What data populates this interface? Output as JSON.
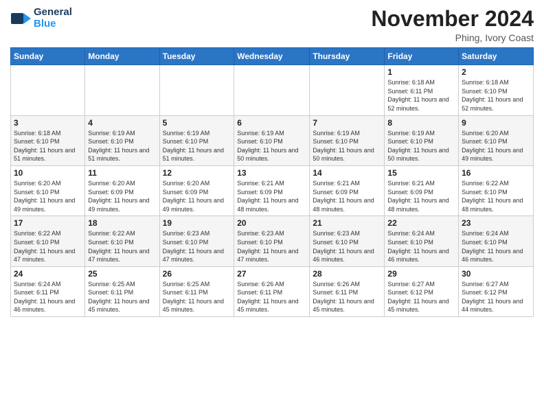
{
  "logo": {
    "line1": "General",
    "line2": "Blue"
  },
  "header": {
    "month": "November 2024",
    "location": "Phing, Ivory Coast"
  },
  "weekdays": [
    "Sunday",
    "Monday",
    "Tuesday",
    "Wednesday",
    "Thursday",
    "Friday",
    "Saturday"
  ],
  "weeks": [
    [
      {
        "day": "",
        "info": ""
      },
      {
        "day": "",
        "info": ""
      },
      {
        "day": "",
        "info": ""
      },
      {
        "day": "",
        "info": ""
      },
      {
        "day": "",
        "info": ""
      },
      {
        "day": "1",
        "info": "Sunrise: 6:18 AM\nSunset: 6:11 PM\nDaylight: 11 hours\nand 52 minutes."
      },
      {
        "day": "2",
        "info": "Sunrise: 6:18 AM\nSunset: 6:10 PM\nDaylight: 11 hours\nand 52 minutes."
      }
    ],
    [
      {
        "day": "3",
        "info": "Sunrise: 6:18 AM\nSunset: 6:10 PM\nDaylight: 11 hours\nand 51 minutes."
      },
      {
        "day": "4",
        "info": "Sunrise: 6:19 AM\nSunset: 6:10 PM\nDaylight: 11 hours\nand 51 minutes."
      },
      {
        "day": "5",
        "info": "Sunrise: 6:19 AM\nSunset: 6:10 PM\nDaylight: 11 hours\nand 51 minutes."
      },
      {
        "day": "6",
        "info": "Sunrise: 6:19 AM\nSunset: 6:10 PM\nDaylight: 11 hours\nand 50 minutes."
      },
      {
        "day": "7",
        "info": "Sunrise: 6:19 AM\nSunset: 6:10 PM\nDaylight: 11 hours\nand 50 minutes."
      },
      {
        "day": "8",
        "info": "Sunrise: 6:19 AM\nSunset: 6:10 PM\nDaylight: 11 hours\nand 50 minutes."
      },
      {
        "day": "9",
        "info": "Sunrise: 6:20 AM\nSunset: 6:10 PM\nDaylight: 11 hours\nand 49 minutes."
      }
    ],
    [
      {
        "day": "10",
        "info": "Sunrise: 6:20 AM\nSunset: 6:10 PM\nDaylight: 11 hours\nand 49 minutes."
      },
      {
        "day": "11",
        "info": "Sunrise: 6:20 AM\nSunset: 6:09 PM\nDaylight: 11 hours\nand 49 minutes."
      },
      {
        "day": "12",
        "info": "Sunrise: 6:20 AM\nSunset: 6:09 PM\nDaylight: 11 hours\nand 49 minutes."
      },
      {
        "day": "13",
        "info": "Sunrise: 6:21 AM\nSunset: 6:09 PM\nDaylight: 11 hours\nand 48 minutes."
      },
      {
        "day": "14",
        "info": "Sunrise: 6:21 AM\nSunset: 6:09 PM\nDaylight: 11 hours\nand 48 minutes."
      },
      {
        "day": "15",
        "info": "Sunrise: 6:21 AM\nSunset: 6:09 PM\nDaylight: 11 hours\nand 48 minutes."
      },
      {
        "day": "16",
        "info": "Sunrise: 6:22 AM\nSunset: 6:10 PM\nDaylight: 11 hours\nand 48 minutes."
      }
    ],
    [
      {
        "day": "17",
        "info": "Sunrise: 6:22 AM\nSunset: 6:10 PM\nDaylight: 11 hours\nand 47 minutes."
      },
      {
        "day": "18",
        "info": "Sunrise: 6:22 AM\nSunset: 6:10 PM\nDaylight: 11 hours\nand 47 minutes."
      },
      {
        "day": "19",
        "info": "Sunrise: 6:23 AM\nSunset: 6:10 PM\nDaylight: 11 hours\nand 47 minutes."
      },
      {
        "day": "20",
        "info": "Sunrise: 6:23 AM\nSunset: 6:10 PM\nDaylight: 11 hours\nand 47 minutes."
      },
      {
        "day": "21",
        "info": "Sunrise: 6:23 AM\nSunset: 6:10 PM\nDaylight: 11 hours\nand 46 minutes."
      },
      {
        "day": "22",
        "info": "Sunrise: 6:24 AM\nSunset: 6:10 PM\nDaylight: 11 hours\nand 46 minutes."
      },
      {
        "day": "23",
        "info": "Sunrise: 6:24 AM\nSunset: 6:10 PM\nDaylight: 11 hours\nand 46 minutes."
      }
    ],
    [
      {
        "day": "24",
        "info": "Sunrise: 6:24 AM\nSunset: 6:11 PM\nDaylight: 11 hours\nand 46 minutes."
      },
      {
        "day": "25",
        "info": "Sunrise: 6:25 AM\nSunset: 6:11 PM\nDaylight: 11 hours\nand 45 minutes."
      },
      {
        "day": "26",
        "info": "Sunrise: 6:25 AM\nSunset: 6:11 PM\nDaylight: 11 hours\nand 45 minutes."
      },
      {
        "day": "27",
        "info": "Sunrise: 6:26 AM\nSunset: 6:11 PM\nDaylight: 11 hours\nand 45 minutes."
      },
      {
        "day": "28",
        "info": "Sunrise: 6:26 AM\nSunset: 6:11 PM\nDaylight: 11 hours\nand 45 minutes."
      },
      {
        "day": "29",
        "info": "Sunrise: 6:27 AM\nSunset: 6:12 PM\nDaylight: 11 hours\nand 45 minutes."
      },
      {
        "day": "30",
        "info": "Sunrise: 6:27 AM\nSunset: 6:12 PM\nDaylight: 11 hours\nand 44 minutes."
      }
    ]
  ]
}
